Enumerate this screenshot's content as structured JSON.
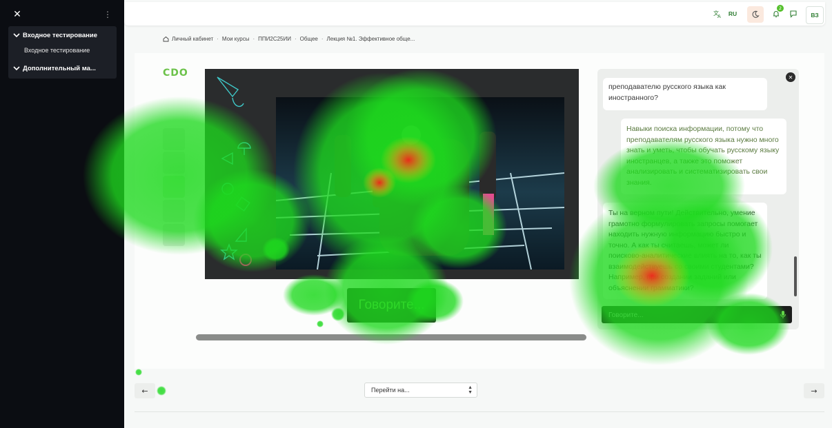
{
  "drawer": {
    "close_icon": "close-icon",
    "menu_icon": "kebab-icon",
    "sections": [
      {
        "label": "Входное тестирование",
        "items": [
          "Входное тестирование"
        ]
      },
      {
        "label": "Дополнительный ма..."
      }
    ]
  },
  "topbar": {
    "lang": "RU",
    "notification_count": "2",
    "user_initials": "ВЗ"
  },
  "breadcrumb": [
    "Личный кабинет",
    "Мои курсы",
    "ППИ2С25ИИ",
    "Общее",
    "Лекция №1. Эффективное обще..."
  ],
  "logo": "CDO",
  "player": {
    "speak_button": "Говорите..."
  },
  "chat": {
    "messages": [
      {
        "role": "bot",
        "text": "преподавателю русского языка как иностранного?"
      },
      {
        "role": "user",
        "text": "Навыки поиска информации, потому что преподавателям русского языка нужно много знать и уметь, чтобы обучать русскому языку иностранцев, а также это поможет анализировать и систематизировать свои знания."
      },
      {
        "role": "bot",
        "text": "Ты на верном пути! Действительно, умение грамотно формулировать запросы помогает находить нужную информацию быстро и точно. А как ты считаешь, может ли поисково-аналитические влиять на то, как ты взаимодействуешь со своими студентами? Например, при создании заданий или объяснении грамматики?"
      }
    ],
    "input_placeholder": "Говорите..."
  },
  "nav": {
    "jump_label": "Перейти на..."
  },
  "colors": {
    "accent": "#6cc24a",
    "drawer_bg": "#0b0d12",
    "heat_green": "#1ed91e",
    "heat_red": "#ff1a1a"
  }
}
